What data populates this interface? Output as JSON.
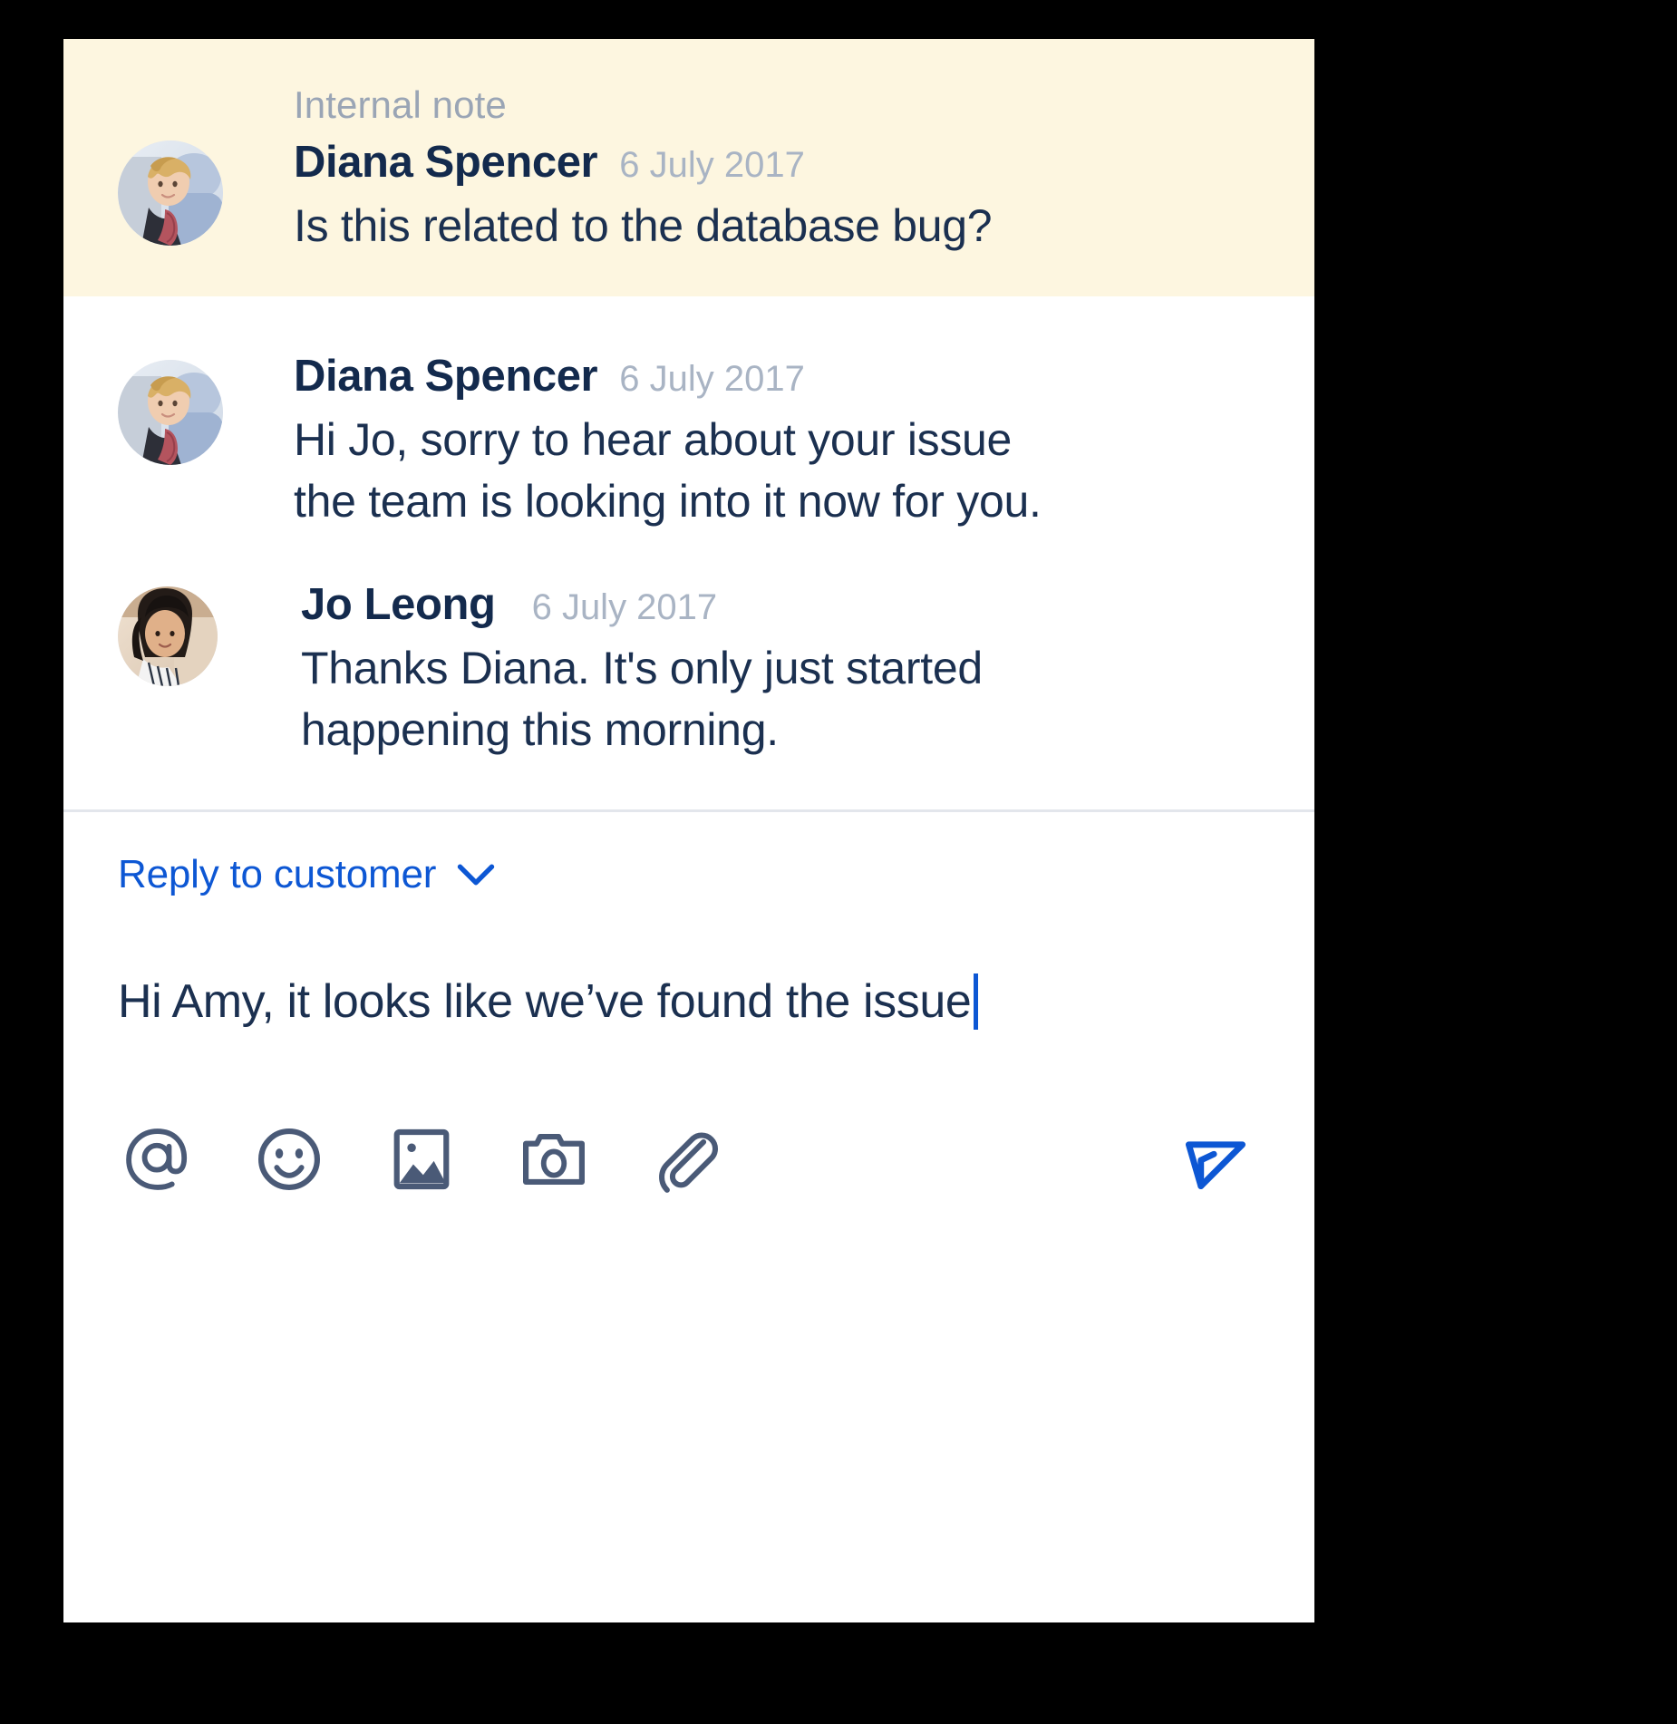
{
  "card": {
    "background": "#ffffff",
    "note_background": "#fdf6e0",
    "accent": "#0d57d4",
    "text_color": "#1b3050",
    "muted_color": "#a9b4c4",
    "icon_color": "#4a5a77"
  },
  "internal_note": {
    "label": "Internal note",
    "author": "Diana Spencer",
    "timestamp": "6 July 2017",
    "message": "Is this related to the database bug?",
    "avatar_name": "diana-spencer-avatar"
  },
  "thread": [
    {
      "author": "Diana Spencer",
      "timestamp": "6 July 2017",
      "lines": [
        "Hi Jo, sorry to hear about your issue",
        "the team is looking into it now for you."
      ],
      "avatar_name": "diana-spencer-avatar"
    },
    {
      "author": "Jo Leong",
      "timestamp": "6 July 2017",
      "lines": [
        "Thanks Diana. It's only just started",
        "happening this morning."
      ],
      "avatar_name": "jo-leong-avatar"
    }
  ],
  "composer": {
    "reply_mode_label": "Reply to customer",
    "chevron_icon": "chevron-down-icon",
    "draft_text": "Hi Amy, it looks like we’ve found the issue",
    "toolbar": [
      {
        "name": "mention-icon",
        "label": "@"
      },
      {
        "name": "emoji-icon",
        "label": "Emoji"
      },
      {
        "name": "image-icon",
        "label": "Insert image"
      },
      {
        "name": "camera-icon",
        "label": "Take photo"
      },
      {
        "name": "attachment-icon",
        "label": "Attach file"
      }
    ],
    "send_button": {
      "name": "send-icon",
      "label": "Send",
      "color": "#0d57d4"
    }
  }
}
